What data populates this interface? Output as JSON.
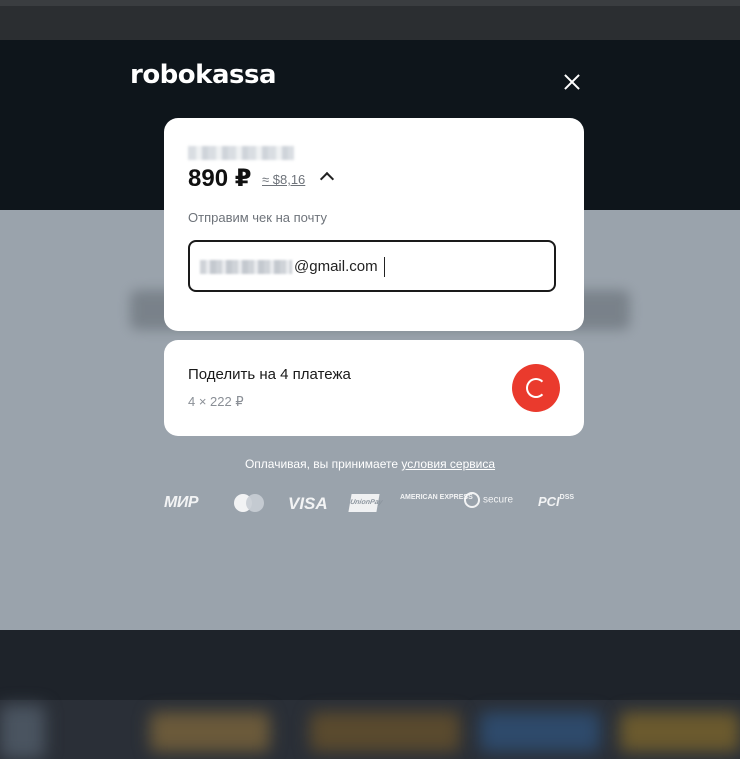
{
  "brand": {
    "logo_text": "robokassa"
  },
  "order": {
    "price": "890 ₽",
    "approx_price": "≈ $8,16",
    "receipt_label": "Отправим чек на почту",
    "email_domain": "@gmail.com"
  },
  "split_payment": {
    "title": "Поделить на 4 платежа",
    "subtitle": "4 × 222 ₽"
  },
  "terms": {
    "prefix": "Оплачивая, вы принимаете ",
    "link": "условия сервиса"
  },
  "payment_logos": {
    "mir": "МИР",
    "visa": "VISA",
    "unionpay": "UnionPay",
    "amex": "AMERICAN EXPRESS",
    "secure": "secure",
    "pci": "PCI",
    "pci_suffix": "DSS"
  },
  "colors": {
    "accent_red": "#ea3a2d",
    "card_bg": "#ffffff",
    "backdrop": "#8a939c"
  }
}
